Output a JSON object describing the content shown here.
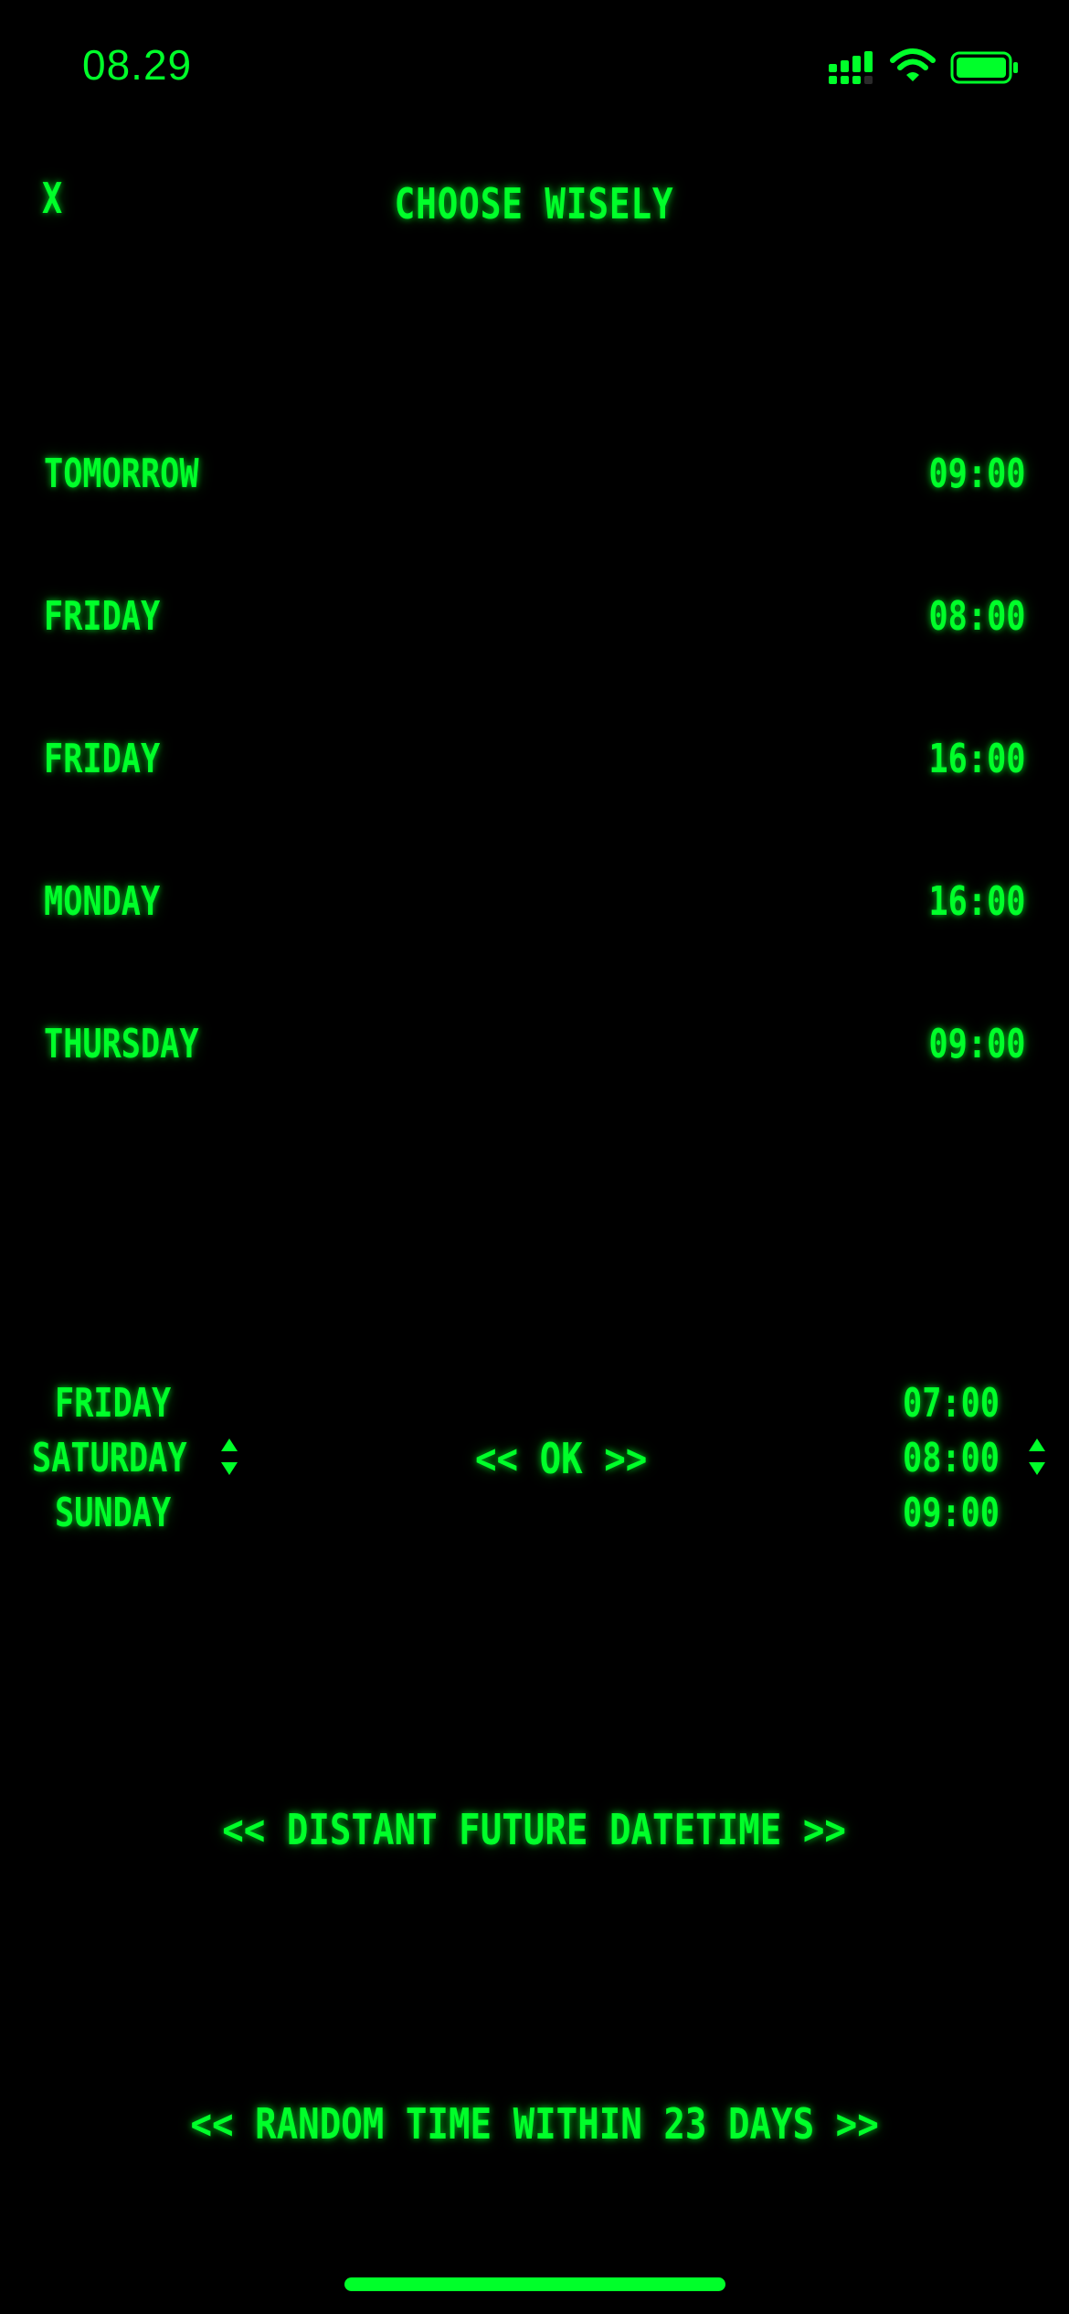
{
  "status_bar": {
    "time": "08.29",
    "icons": [
      "signal-icon",
      "wifi-icon",
      "battery-icon"
    ]
  },
  "header": {
    "close_label": "X",
    "title": "CHOOSE WISELY"
  },
  "options": [
    {
      "day": "TOMORROW",
      "time": "09:00"
    },
    {
      "day": "FRIDAY",
      "time": "08:00"
    },
    {
      "day": "FRIDAY",
      "time": "16:00"
    },
    {
      "day": "MONDAY",
      "time": "16:00"
    },
    {
      "day": "THURSDAY",
      "time": "09:00"
    }
  ],
  "picker": {
    "days": {
      "prev": "FRIDAY",
      "selected": "SATURDAY",
      "next": "SUNDAY"
    },
    "times": {
      "prev": "07:00",
      "selected": "08:00",
      "next": "09:00"
    },
    "ok_label": "<< OK >>"
  },
  "actions": {
    "distant_future": "<< DISTANT FUTURE DATETIME >>",
    "random_time": "<< RANDOM TIME WITHIN 23 DAYS >>"
  },
  "colors": {
    "background": "#000000",
    "accent": "#00ff2a"
  }
}
